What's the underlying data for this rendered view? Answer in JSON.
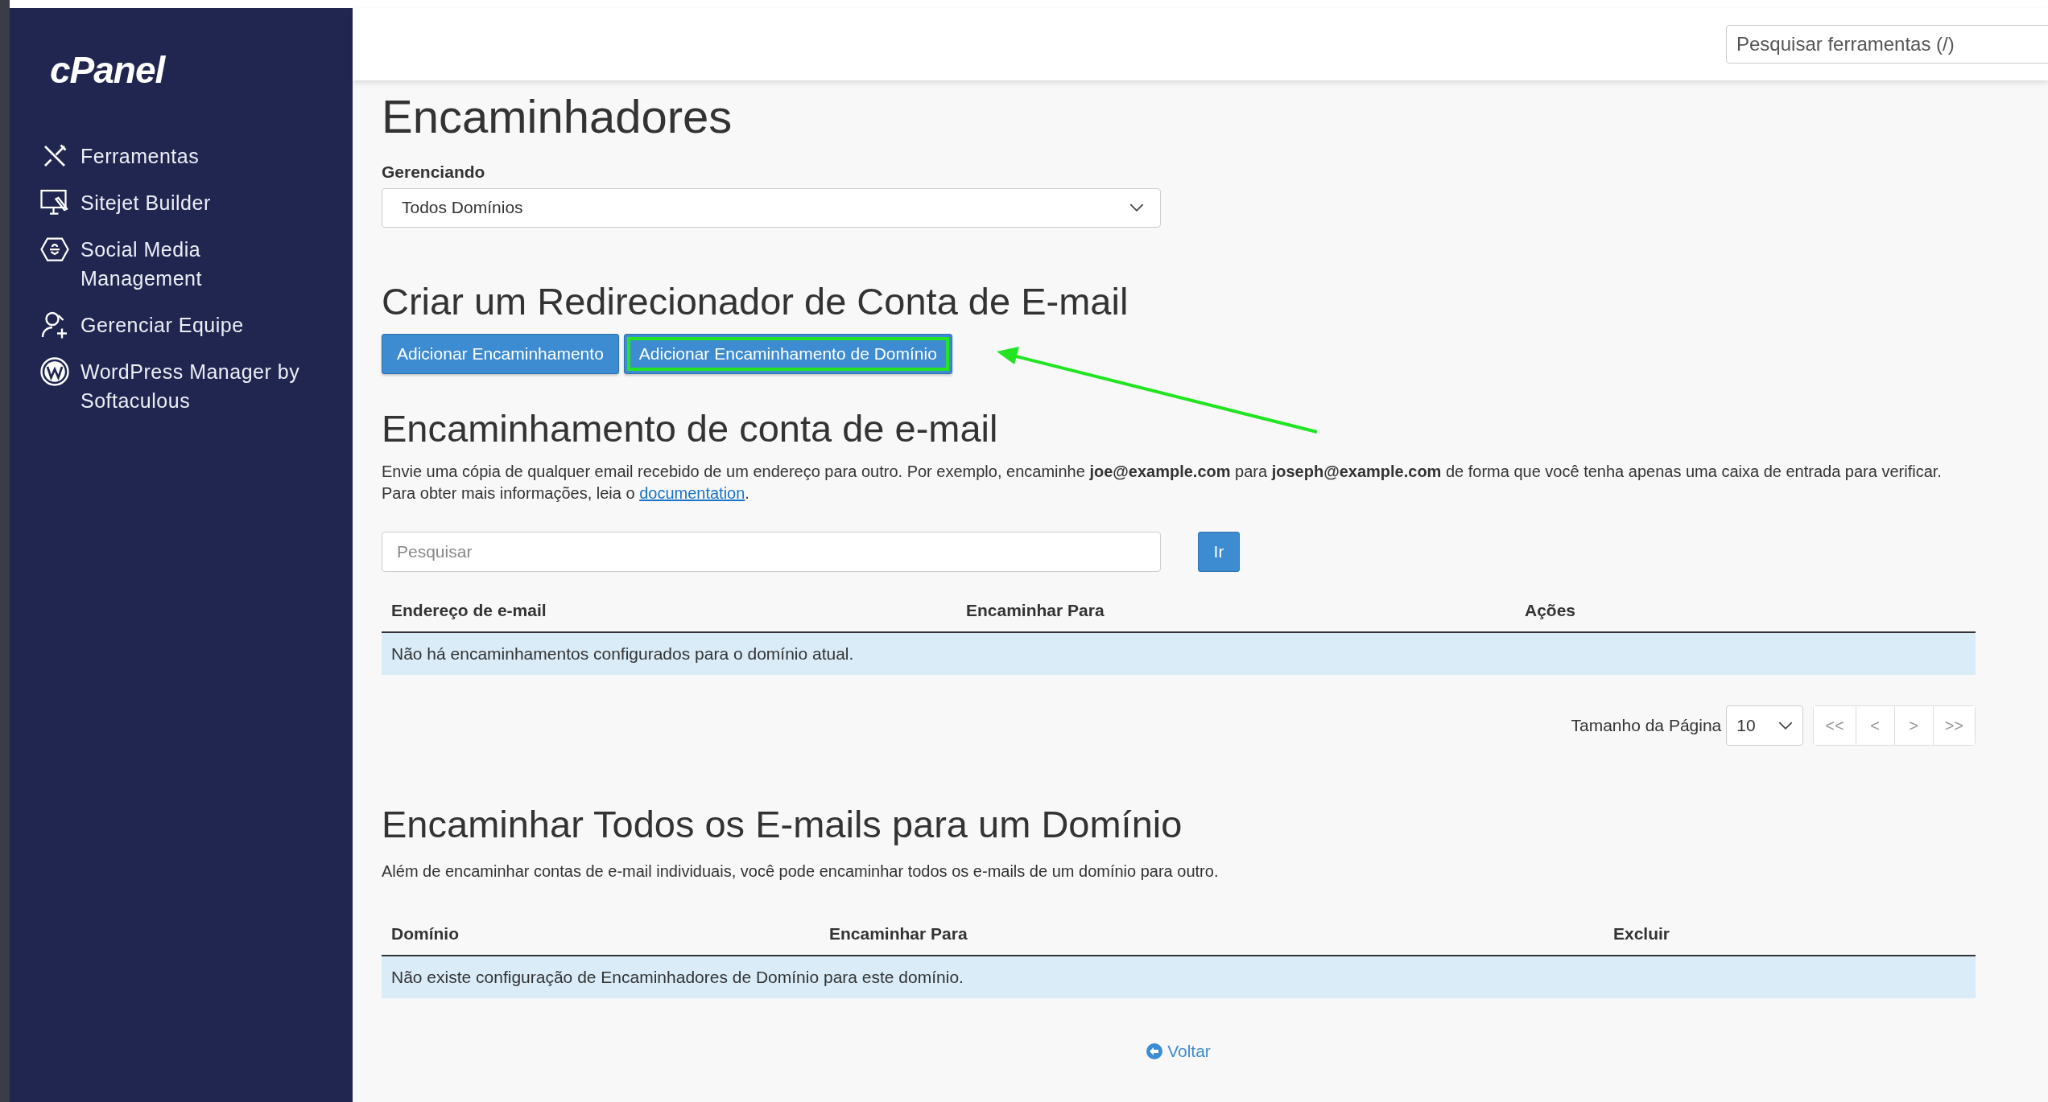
{
  "sidebar": {
    "logo": "cPanel",
    "items": [
      {
        "label": "Ferramentas",
        "kind": "tools"
      },
      {
        "label": "Sitejet Builder",
        "kind": "monitor"
      },
      {
        "label": "Social Media Management",
        "kind": "hexagon"
      },
      {
        "label": "Gerenciar Equipe",
        "kind": "team"
      },
      {
        "label": "WordPress Manager by Softaculous",
        "kind": "wordpress"
      }
    ]
  },
  "header": {
    "search": {
      "placeholder": "Pesquisar ferramentas (/)"
    }
  },
  "page": {
    "title": "Encaminhadores",
    "managing_label": "Gerenciando",
    "managing_value": "Todos Domínios"
  },
  "create_section": {
    "heading": "Criar um Redirecionador de Conta de E-mail",
    "buttons": [
      {
        "label": "Adicionar Encaminhamento",
        "highlighted": false
      },
      {
        "label": "Adicionar Encaminhamento de Domínio",
        "highlighted": true
      }
    ]
  },
  "account_section": {
    "heading": "Encaminhamento de conta de e-mail",
    "description": "Envie uma cópia de qualquer email recebido de um endereço para outro. Por exemplo, encaminhe **joe@example.com** para **joseph@example.com** de forma que você tenha apenas uma caixa de entrada para verificar. Para obter mais informações, leia o ",
    "link": "documentation",
    "description_end": ".",
    "search": {
      "placeholder": "Pesquisar"
    },
    "go_button": "Ir",
    "table": {
      "columns": [
        "Endereço de e-mail",
        "Encaminhar Para",
        "Ações"
      ],
      "empty_message": "Não há encaminhamentos configurados para o domínio atual."
    },
    "pagination": {
      "label": "Tamanho da Página",
      "page_size": "10",
      "buttons": [
        {
          "label": "<<",
          "disabled": true
        },
        {
          "label": "<",
          "disabled": true
        },
        {
          "label": ">",
          "disabled": true
        },
        {
          "label": ">>",
          "disabled": true
        }
      ]
    }
  },
  "domain_section": {
    "heading": "Encaminhar Todos os E-mails para um Domínio",
    "description": "Além de encaminhar contas de e-mail individuais, você pode encaminhar todos os e-mails de um domínio para outro.",
    "table": {
      "columns": [
        "Domínio",
        "Encaminhar Para",
        "Excluir"
      ],
      "empty_message": "Não existe configuração de Encaminhadores de Domínio para este domínio."
    }
  },
  "back_link": "Voltar"
}
